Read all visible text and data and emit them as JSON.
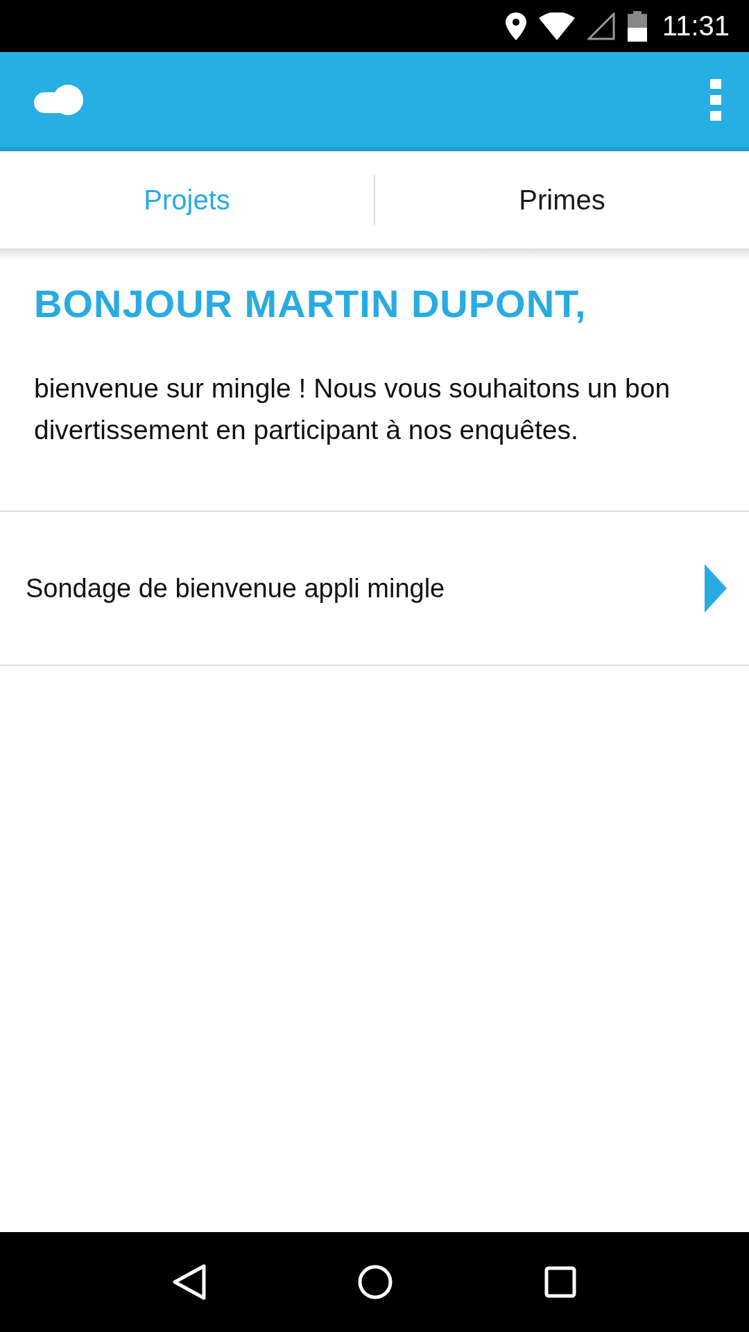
{
  "status_bar": {
    "time": "11:31"
  },
  "tabs": [
    {
      "label": "Projets",
      "selected": true
    },
    {
      "label": "Primes",
      "selected": false
    }
  ],
  "greeting": {
    "title": "BONJOUR MARTIN DUPONT,",
    "message": "bienvenue sur mingle ! Nous vous souhaitons un bon divertissement en participant à nos enquêtes."
  },
  "surveys": [
    {
      "title": "Sondage de bienvenue appli mingle"
    }
  ]
}
